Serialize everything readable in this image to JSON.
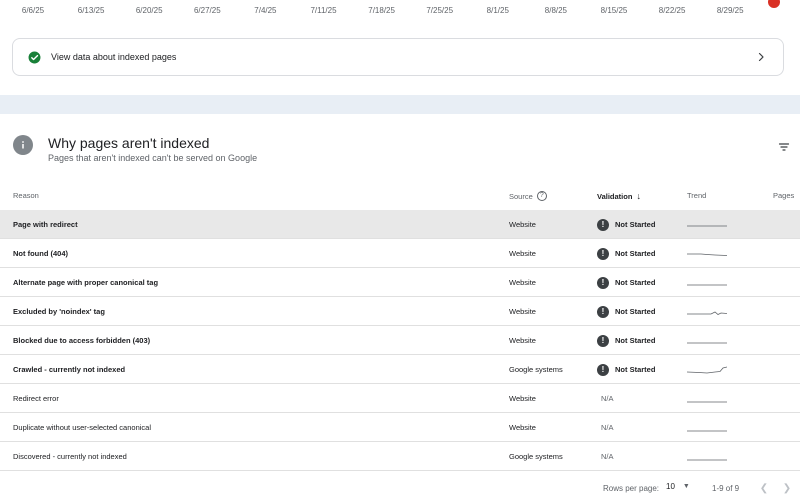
{
  "date_axis": [
    "6/6/25",
    "6/13/25",
    "6/20/25",
    "6/27/25",
    "7/4/25",
    "7/11/25",
    "7/18/25",
    "7/25/25",
    "8/1/25",
    "8/8/25",
    "8/15/25",
    "8/22/25",
    "8/29/25"
  ],
  "indexed_card": {
    "label": "View data about indexed pages",
    "icon": "check-circle-icon",
    "color": "#188038"
  },
  "section": {
    "title": "Why pages aren't indexed",
    "subtitle": "Pages that aren't indexed can't be served on Google"
  },
  "table": {
    "headers": {
      "reason": "Reason",
      "source": "Source",
      "validation": "Validation",
      "trend": "Trend",
      "pages": "Pages"
    },
    "rows": [
      {
        "reason": "Page with redirect",
        "source": "Website",
        "validation": "Not Started",
        "trend": "flat"
      },
      {
        "reason": "Not found (404)",
        "source": "Website",
        "validation": "Not Started",
        "trend": "flat-dip"
      },
      {
        "reason": "Alternate page with proper canonical tag",
        "source": "Website",
        "validation": "Not Started",
        "trend": "flat"
      },
      {
        "reason": "Excluded by 'noindex' tag",
        "source": "Website",
        "validation": "Not Started",
        "trend": "bump"
      },
      {
        "reason": "Blocked due to access forbidden (403)",
        "source": "Website",
        "validation": "Not Started",
        "trend": "flat"
      },
      {
        "reason": "Crawled - currently not indexed",
        "source": "Google systems",
        "validation": "Not Started",
        "trend": "rise"
      },
      {
        "reason": "Redirect error",
        "source": "Website",
        "validation": "N/A",
        "trend": "flat"
      },
      {
        "reason": "Duplicate without user-selected canonical",
        "source": "Website",
        "validation": "N/A",
        "trend": "flat"
      },
      {
        "reason": "Discovered - currently not indexed",
        "source": "Google systems",
        "validation": "N/A",
        "trend": "flat"
      }
    ]
  },
  "pagination": {
    "label": "Rows per page:",
    "rows_per_page": "10",
    "range": "1-9 of 9"
  }
}
